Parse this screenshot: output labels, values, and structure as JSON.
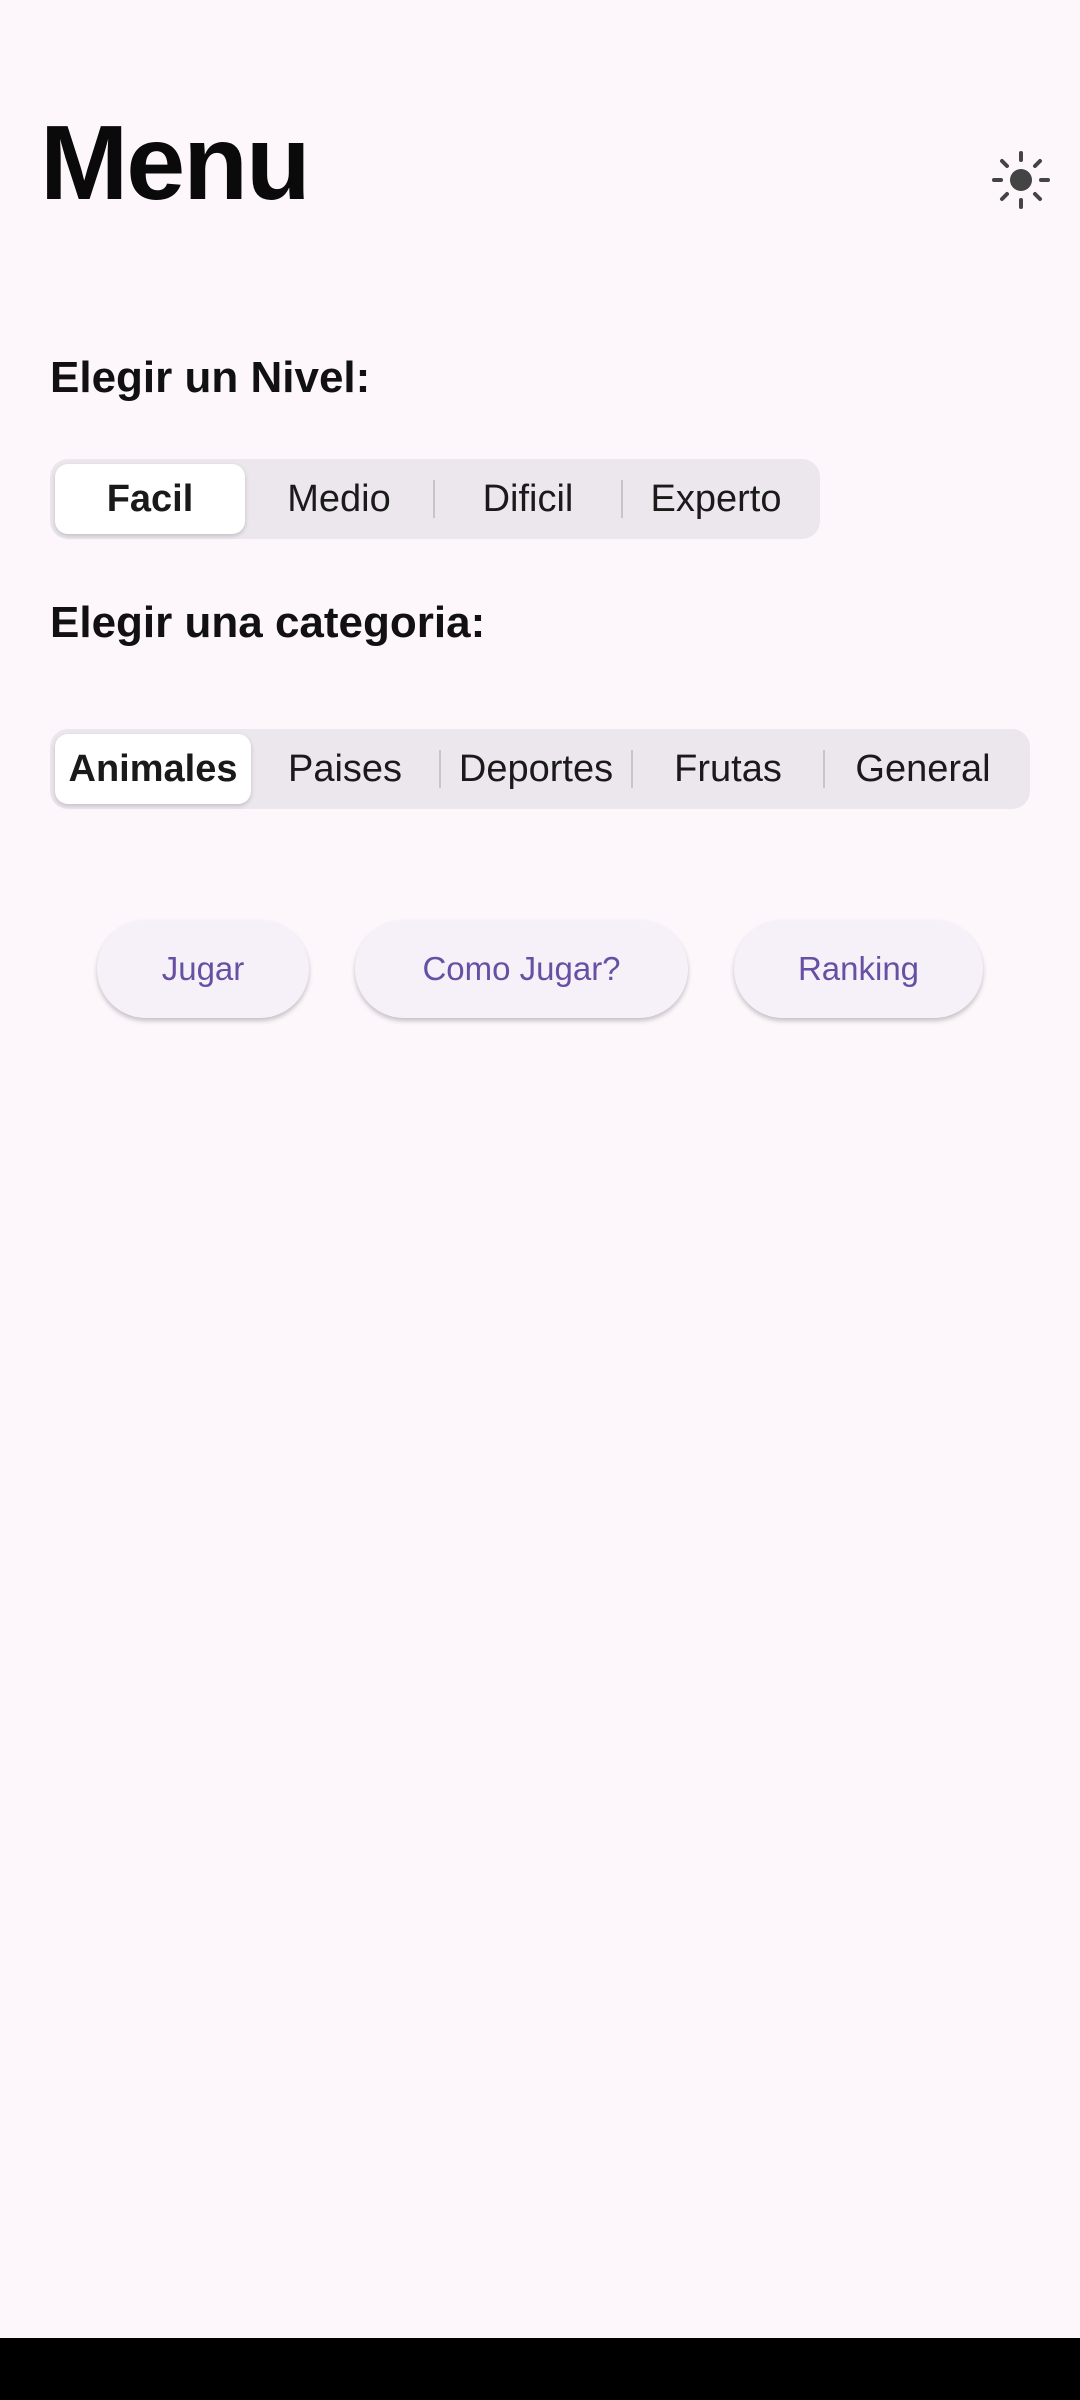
{
  "header": {
    "title": "Menu",
    "theme_icon": "sun-icon"
  },
  "level": {
    "label": "Elegir un Nivel:",
    "options": [
      "Facil",
      "Medio",
      "Dificil",
      "Experto"
    ],
    "selected": "Facil"
  },
  "category": {
    "label": "Elegir una categoria:",
    "options": [
      "Animales",
      "Paises",
      "Deportes",
      "Frutas",
      "General"
    ],
    "selected": "Animales"
  },
  "actions": {
    "play": "Jugar",
    "how_to_play": "Como Jugar?",
    "ranking": "Ranking"
  },
  "colors": {
    "background": "#fdf7fc",
    "accent": "#6750a4",
    "segment_track": "#ece7ed"
  }
}
